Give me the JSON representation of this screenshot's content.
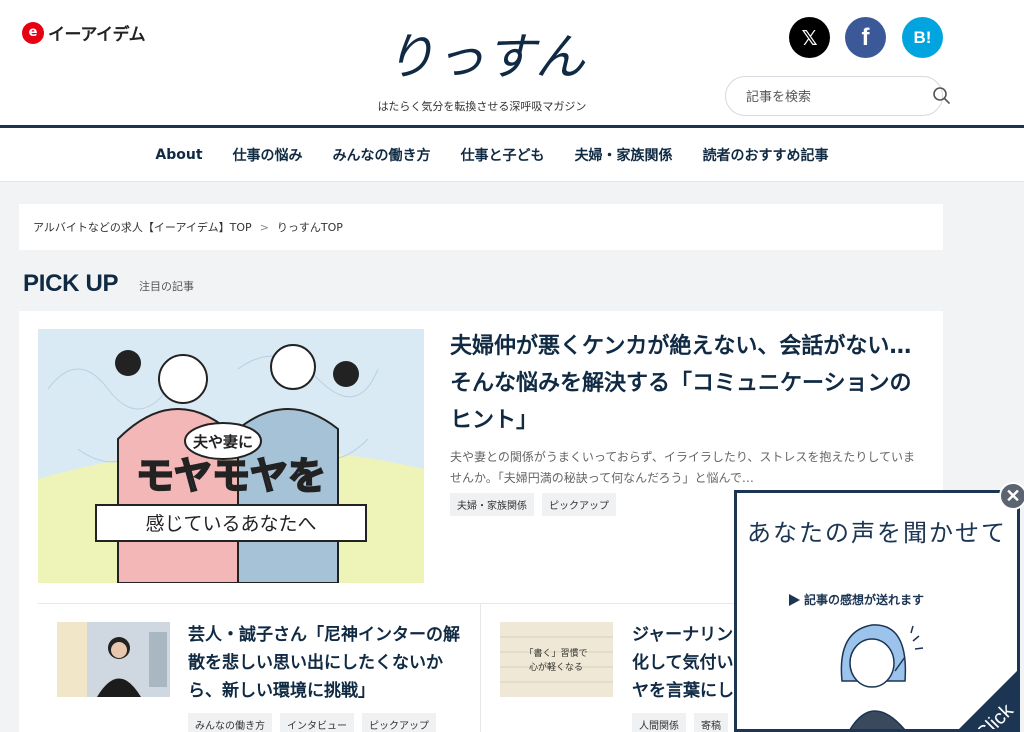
{
  "header": {
    "brand_mark": "e",
    "brand_name": "イーアイデム",
    "site_logo_text": "りっすん",
    "tagline": "はたらく気分を転換させる深呼吸マガジン",
    "social": {
      "x": "𝕏",
      "facebook": "f",
      "hatena": "B!"
    },
    "search_placeholder": "記事を検索"
  },
  "nav": {
    "items": [
      "About",
      "仕事の悩み",
      "みんなの働き方",
      "仕事と子ども",
      "夫婦・家族関係",
      "読者のおすすめ記事"
    ]
  },
  "breadcrumb": {
    "items": [
      "アルバイトなどの求人【イーアイデム】TOP",
      "りっすんTOP"
    ],
    "separator": ">"
  },
  "pickup": {
    "title": "PICK UP",
    "subtitle": "注目の記事",
    "hero": {
      "image_text": {
        "bubble": "夫や妻に",
        "main": "モヤモヤを",
        "bottom": "感じているあなたへ"
      },
      "title": "夫婦仲が悪くケンカが絶えない、会話がない…そんな悩みを解決する「コミュニケーションのヒント」",
      "description": "夫や妻との関係がうまくいっておらず、イライラしたり、ストレスを抱えたりしていませんか。「夫婦円満の秘訣って何なんだろう」と悩んで…",
      "tags": [
        "夫婦・家族関係",
        "ピックアップ"
      ]
    },
    "articles": [
      {
        "title": "芸人・誠子さん「尼神インターの解散を悲しい思い出にしたくないから、新しい環境に挑戦」",
        "tags": [
          "みんなの働き方",
          "インタビュー",
          "ピックアップ"
        ]
      },
      {
        "title": "ジャーナリン化して気付いヤを言葉にし",
        "thumb_text": {
          "line1": "「書く」習慣で",
          "line2": "心が軽くなる"
        },
        "tags": [
          "人間関係",
          "寄稿"
        ]
      }
    ]
  },
  "popup": {
    "title": "あなたの声を聞かせて",
    "subtitle": "記事の感想が送れます",
    "click_label": "Click",
    "close_label": "✕"
  },
  "colors": {
    "navy": "#102a43",
    "accent_red": "#e60012",
    "popup_navy": "#1b3553"
  }
}
